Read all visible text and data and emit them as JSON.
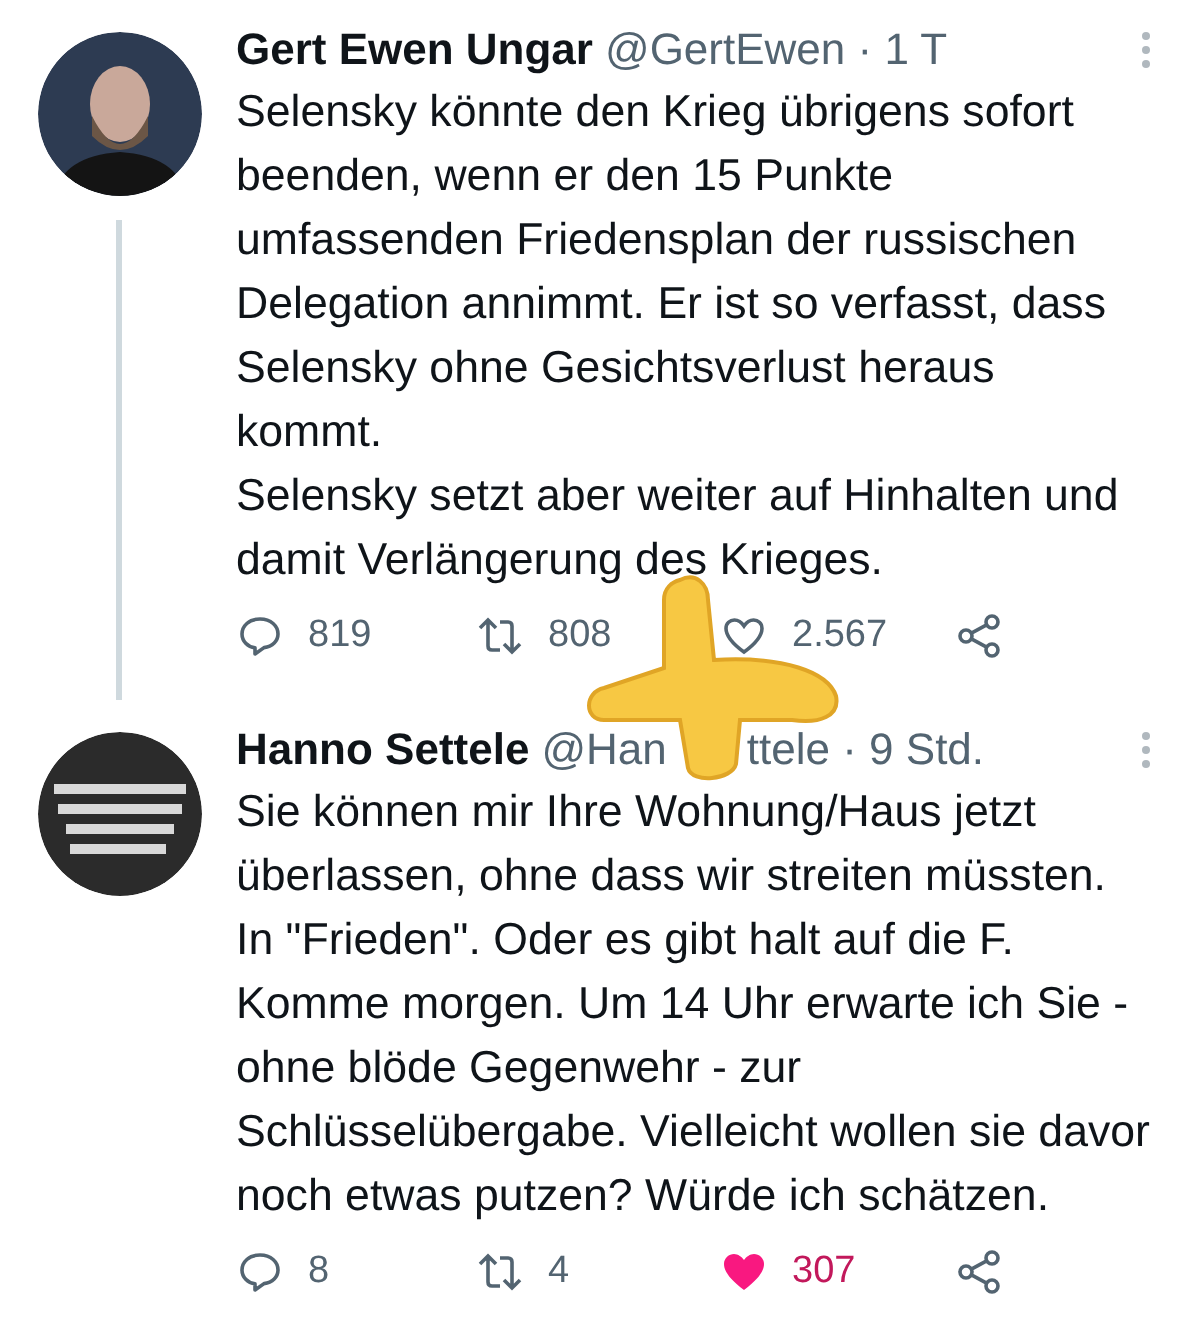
{
  "tweets": [
    {
      "name": "Gert Ewen Ungar",
      "handle_parts": [
        "@GertEwen"
      ],
      "time": "· 1 T",
      "thread_line": true,
      "text": "Selensky könnte den Krieg übrigens sofort\nbeenden, wenn er den 15 Punkte\numfassenden Friedensplan der russischen\nDelegation annimmt. Er ist so verfasst, dass\nSelensky ohne Gesichtsverlust heraus\nkommt.\nSelensky setzt aber weiter auf Hinhalten und\ndamit Verlängerung des Krieges.",
      "replies": "819",
      "retweets": "808",
      "likes": "2.567",
      "liked": false
    },
    {
      "name": "Hanno Settele",
      "handle_parts": [
        "@Han",
        "ttele"
      ],
      "time": "· 9 Std.",
      "thread_line": false,
      "text": "Sie können mir Ihre Wohnung/Haus jetzt\nüberlassen, ohne dass wir streiten müssten.\nIn \"Frieden\". Oder es gibt halt auf die F.\nKomme morgen. Um 14 Uhr erwarte ich Sie -\nohne blöde Gegenwehr - zur\nSchlüsselübergabe. Vielleicht wollen sie davor\nnoch etwas putzen? Würde ich schätzen.",
      "replies": "8",
      "retweets": "4",
      "likes": "307",
      "liked": true
    }
  ]
}
